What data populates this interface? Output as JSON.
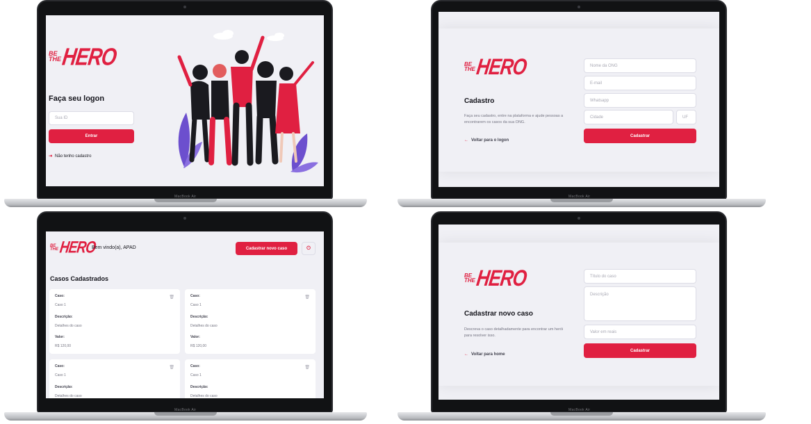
{
  "logo": {
    "be": "BE",
    "the": "THE",
    "hero": "HERO"
  },
  "laptop_label": "MacBook Air",
  "logon": {
    "title": "Faça seu logon",
    "id_placeholder": "Sua ID",
    "submit": "Entrar",
    "register_link": "Não tenho cadastro",
    "link_icon": "log-in-icon"
  },
  "register": {
    "title": "Cadastro",
    "description": "Faça seu cadastro, entre na plataforma e ajude pessoas a encontrarem os casos da sua ONG.",
    "back_link": "Voltar para o logon",
    "fields": {
      "name": "Nome da ONG",
      "email": "E-mail",
      "whatsapp": "Whatsapp",
      "city": "Cidade",
      "uf": "UF"
    },
    "submit": "Cadastrar"
  },
  "profile": {
    "welcome": "Bem vindo(a), APAD",
    "new_case_button": "Cadastrar novo caso",
    "logout_icon": "power-icon",
    "list_title": "Casos Cadastrados",
    "case_label": "Caso:",
    "description_label": "Descrição:",
    "value_label": "Valor:",
    "cases": [
      {
        "title": "Caso 1",
        "description": "Detalhes do caso",
        "value": "R$ 120,00"
      },
      {
        "title": "Caso 1",
        "description": "Detalhes do caso",
        "value": "R$ 120,00"
      },
      {
        "title": "Caso 1",
        "description": "Detalhes do caso",
        "value": ""
      },
      {
        "title": "Caso 1",
        "description": "Detalhes do caso",
        "value": ""
      }
    ]
  },
  "new_incident": {
    "title": "Cadastrar novo caso",
    "description": "Descreva o caso detalhadamente para encontrar um herói para resolver isso.",
    "back_link": "Voltar para home",
    "fields": {
      "title": "Título do caso",
      "description": "Descrição",
      "value": "Valor em reais"
    },
    "submit": "Cadastrar"
  },
  "colors": {
    "brand": "#e02041",
    "background": "#f0f0f5",
    "text": "#13131a",
    "muted": "#737380"
  }
}
